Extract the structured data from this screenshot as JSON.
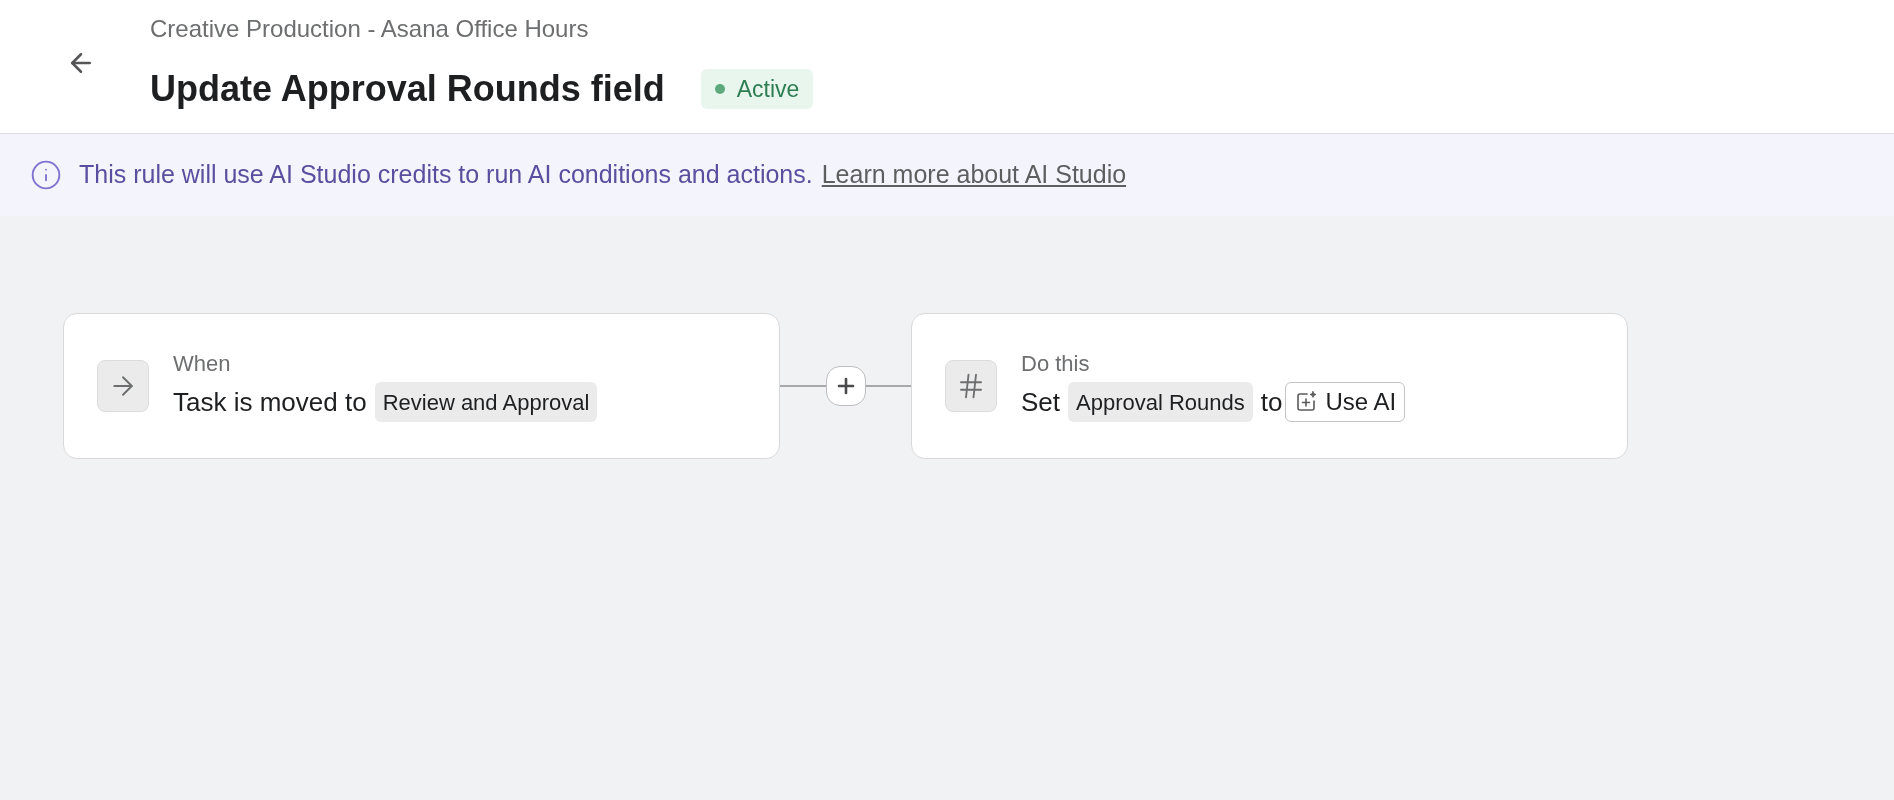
{
  "header": {
    "breadcrumb": "Creative Production - Asana Office Hours",
    "title": "Update Approval Rounds field",
    "status": {
      "kind": "active",
      "label": "Active"
    }
  },
  "banner": {
    "text": "This rule will use AI Studio credits to run AI conditions and actions.",
    "link": "Learn more about AI Studio"
  },
  "steps": [
    {
      "kind": "trigger",
      "heading": "When",
      "text": "Task is moved to",
      "value": "Review and Approval"
    },
    {
      "kind": "action",
      "heading": "Do this",
      "text": "Set",
      "value": "Approval Rounds",
      "connector": "to",
      "button": "Use AI"
    }
  ]
}
